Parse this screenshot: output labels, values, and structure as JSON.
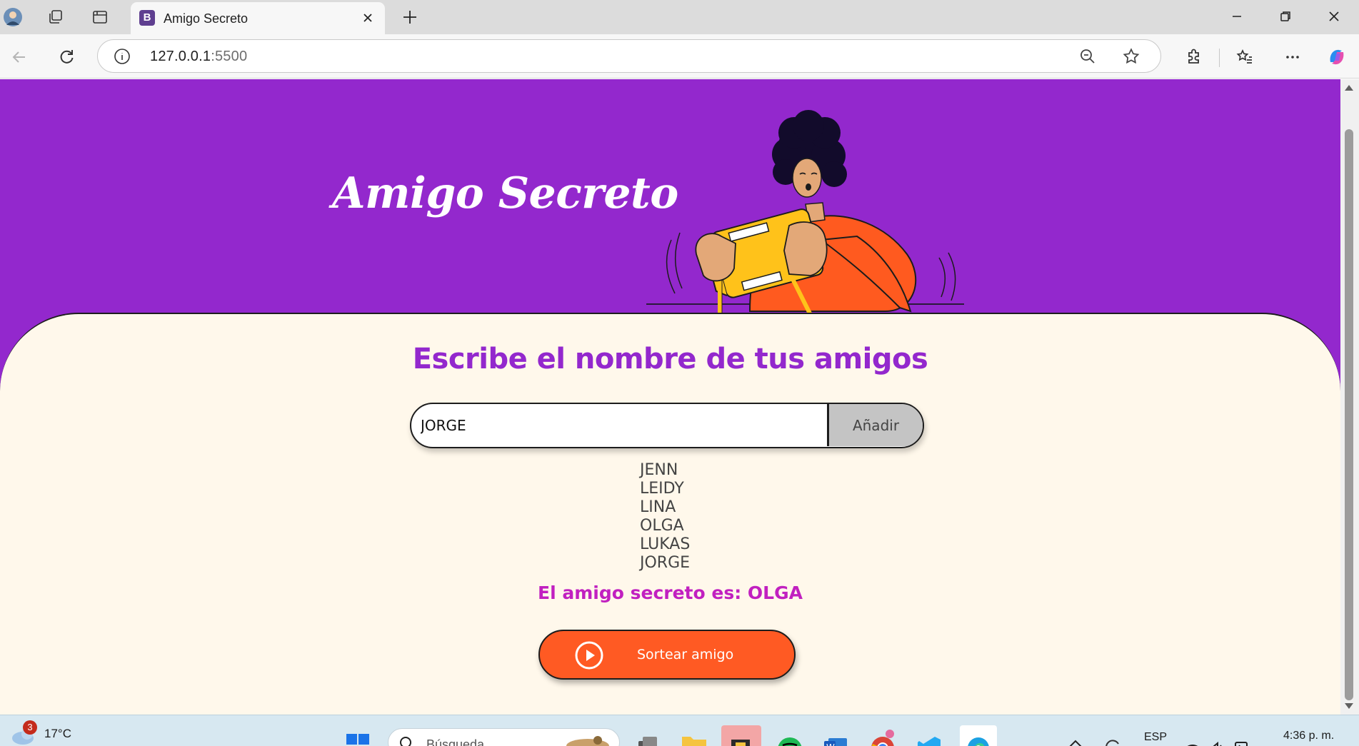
{
  "browser": {
    "tab_title": "Amigo Secreto",
    "tab_favicon_letter": "B",
    "url_host": "127.0.0.1",
    "url_port": ":5500"
  },
  "page": {
    "app_title": "Amigo Secreto",
    "section_title": "Escribe el nombre de tus amigos",
    "name_input_value": "JORGE",
    "add_button_label": "Añadir",
    "friends": [
      "JENN",
      "LEIDY",
      "LINA",
      "OLGA",
      "LUKAS",
      "JORGE"
    ],
    "result_text": "El amigo secreto es: OLGA",
    "draw_button_label": "Sortear amigo"
  },
  "taskbar": {
    "weather_badge": "3",
    "temperature": "17°C",
    "search_placeholder": "Búsqueda",
    "language": "ESP",
    "clock": "4:36 p. m."
  },
  "colors": {
    "header_bg": "#9328cd",
    "content_bg": "#fff8eb",
    "title_purple": "#9328cd",
    "result_magenta": "#c120c0",
    "draw_button": "#ff5a23",
    "add_button": "#c4c4c4"
  }
}
